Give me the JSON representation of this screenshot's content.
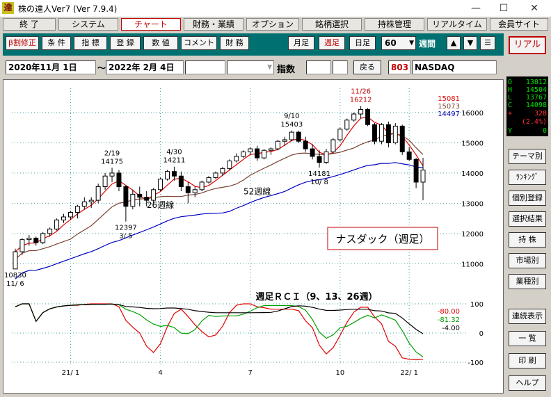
{
  "window": {
    "app_icon": "達",
    "title": "株の達人Ver7 (Ver 7.9.4)",
    "minimize": "—",
    "maximize": "☐",
    "close": "✕"
  },
  "menu": [
    "終 了",
    "システム",
    "チャート",
    "財務・業績",
    "オプション",
    "銘柄選択",
    "持株管理",
    "リアルタイム",
    "会員サイト"
  ],
  "toolbar": {
    "buttons": [
      "β割修正",
      "条 件",
      "指 標",
      "登 録",
      "数 値",
      "コメント",
      "財 務"
    ],
    "periods": [
      "月足",
      "週足",
      "日足"
    ],
    "count": "60",
    "span_label": "週間",
    "nav": [
      "▲",
      "▼",
      "☰"
    ],
    "real_button": "リアル"
  },
  "range": {
    "start": "2020年11月 1日",
    "tilde": "〜",
    "end": "2022年 2月 4日",
    "index_label": "指数",
    "back_button": "戻る",
    "code": "803",
    "symbol": "NASDAQ"
  },
  "quote": {
    "O": "13812",
    "H": "14504",
    "L": "13767",
    "C": "14098",
    "change": "328",
    "change_pct": "(2.4%)",
    "Y": "0",
    "plus": "+",
    "O_lab": "O",
    "H_lab": "H",
    "L_lab": "L",
    "C_lab": "C",
    "Y_lab": "Y"
  },
  "side_buttons": [
    "テーマ別",
    "ﾗﾝｷﾝｸﾞ",
    "個別登録",
    "選択結果",
    "持 株",
    "市場別",
    "業種別",
    "連続表示",
    "一 覧",
    "印 刷",
    "ヘルプ"
  ],
  "colors": {
    "accent_red": "#c00000",
    "ma_short": "#e00000",
    "ma_26": "#7a4030",
    "ma_52": "#0000c0",
    "rci9": "#e00000",
    "rci13": "#00a000",
    "rci26": "#000000",
    "grid": "#40a0a0"
  },
  "chart_data": {
    "type": "candlestick",
    "title": "ナスダック（週足）",
    "period_count": 60,
    "ylim": [
      10000,
      16800
    ],
    "yticks": [
      11000,
      12000,
      13000,
      14000,
      15000,
      16000
    ],
    "xticks": [
      "21/ 1",
      "4",
      "7",
      "10",
      "22/ 1"
    ],
    "ma_legend": [
      "15081",
      "15073",
      "14497"
    ],
    "ma_labels": [
      "26週線",
      "52週線"
    ],
    "annotations": [
      {
        "price": "10830",
        "date": "11/ 6"
      },
      {
        "price": "14175",
        "date": "2/19"
      },
      {
        "price": "12397",
        "date": "3/ 5"
      },
      {
        "price": "14211",
        "date": "4/30"
      },
      {
        "price": "15403",
        "date": "9/10"
      },
      {
        "price": "14181",
        "date": "10/ 8"
      },
      {
        "price": "16212",
        "date": "11/26"
      }
    ],
    "candles_ohlc": [
      [
        10830,
        11500,
        10830,
        11400
      ],
      [
        11400,
        11850,
        11300,
        11800
      ],
      [
        11800,
        11950,
        11600,
        11850
      ],
      [
        11850,
        11900,
        11600,
        11700
      ],
      [
        11700,
        12050,
        11650,
        12000
      ],
      [
        12000,
        12200,
        11900,
        12150
      ],
      [
        12150,
        12500,
        12100,
        12450
      ],
      [
        12450,
        12650,
        12350,
        12550
      ],
      [
        12550,
        12750,
        12450,
        12700
      ],
      [
        12700,
        12950,
        12500,
        12900
      ],
      [
        12900,
        13200,
        12800,
        13050
      ],
      [
        13050,
        13200,
        12850,
        13100
      ],
      [
        13100,
        13650,
        13000,
        13550
      ],
      [
        13550,
        14000,
        13450,
        13900
      ],
      [
        13900,
        14175,
        13700,
        14000
      ],
      [
        14000,
        14100,
        13400,
        13550
      ],
      [
        13550,
        13600,
        12397,
        12900
      ],
      [
        12900,
        13450,
        12800,
        13300
      ],
      [
        13300,
        13550,
        12900,
        13200
      ],
      [
        13200,
        13400,
        12900,
        13100
      ],
      [
        13100,
        13500,
        13000,
        13450
      ],
      [
        13450,
        13850,
        13400,
        13800
      ],
      [
        13800,
        14100,
        13750,
        14050
      ],
      [
        14050,
        14211,
        13750,
        13900
      ],
      [
        13900,
        14050,
        13400,
        13550
      ],
      [
        13550,
        13700,
        13000,
        13350
      ],
      [
        13350,
        13550,
        13200,
        13450
      ],
      [
        13450,
        13750,
        13400,
        13700
      ],
      [
        13700,
        13900,
        13650,
        13850
      ],
      [
        13850,
        14050,
        13800,
        14000
      ],
      [
        14000,
        14200,
        13900,
        14150
      ],
      [
        14150,
        14450,
        14100,
        14400
      ],
      [
        14400,
        14650,
        14350,
        14550
      ],
      [
        14550,
        14750,
        14500,
        14700
      ],
      [
        14700,
        14850,
        14600,
        14800
      ],
      [
        14800,
        14900,
        14400,
        14500
      ],
      [
        14500,
        14800,
        14450,
        14750
      ],
      [
        14750,
        14850,
        14600,
        14800
      ],
      [
        14800,
        15100,
        14750,
        15050
      ],
      [
        15050,
        15200,
        14900,
        15100
      ],
      [
        15100,
        15403,
        15050,
        15350
      ],
      [
        15350,
        15400,
        15000,
        15050
      ],
      [
        15050,
        15200,
        14700,
        14800
      ],
      [
        14800,
        14950,
        14450,
        14550
      ],
      [
        14550,
        14750,
        14181,
        14350
      ],
      [
        14350,
        14800,
        14300,
        14700
      ],
      [
        14700,
        15150,
        14650,
        15100
      ],
      [
        15100,
        15500,
        15050,
        15450
      ],
      [
        15450,
        15800,
        15400,
        15750
      ],
      [
        15750,
        16000,
        15700,
        15950
      ],
      [
        15950,
        16212,
        15800,
        16100
      ],
      [
        16100,
        16150,
        15550,
        15600
      ],
      [
        15600,
        15650,
        14950,
        15050
      ],
      [
        15050,
        15650,
        14950,
        15600
      ],
      [
        15600,
        15700,
        14850,
        15000
      ],
      [
        15000,
        15650,
        14950,
        15550
      ],
      [
        15550,
        15600,
        14600,
        14700
      ],
      [
        14700,
        14850,
        14400,
        14450
      ],
      [
        14450,
        14500,
        13500,
        13700
      ],
      [
        13700,
        14504,
        13100,
        14098
      ]
    ],
    "rci_title": "週足ＲＣＩ（9、13、26週）",
    "rci_ylim": [
      -100,
      100
    ],
    "rci_yticks": [
      100,
      0,
      -100
    ],
    "rci_values": [
      "-80.00",
      "-81.32",
      "-4.00"
    ]
  }
}
